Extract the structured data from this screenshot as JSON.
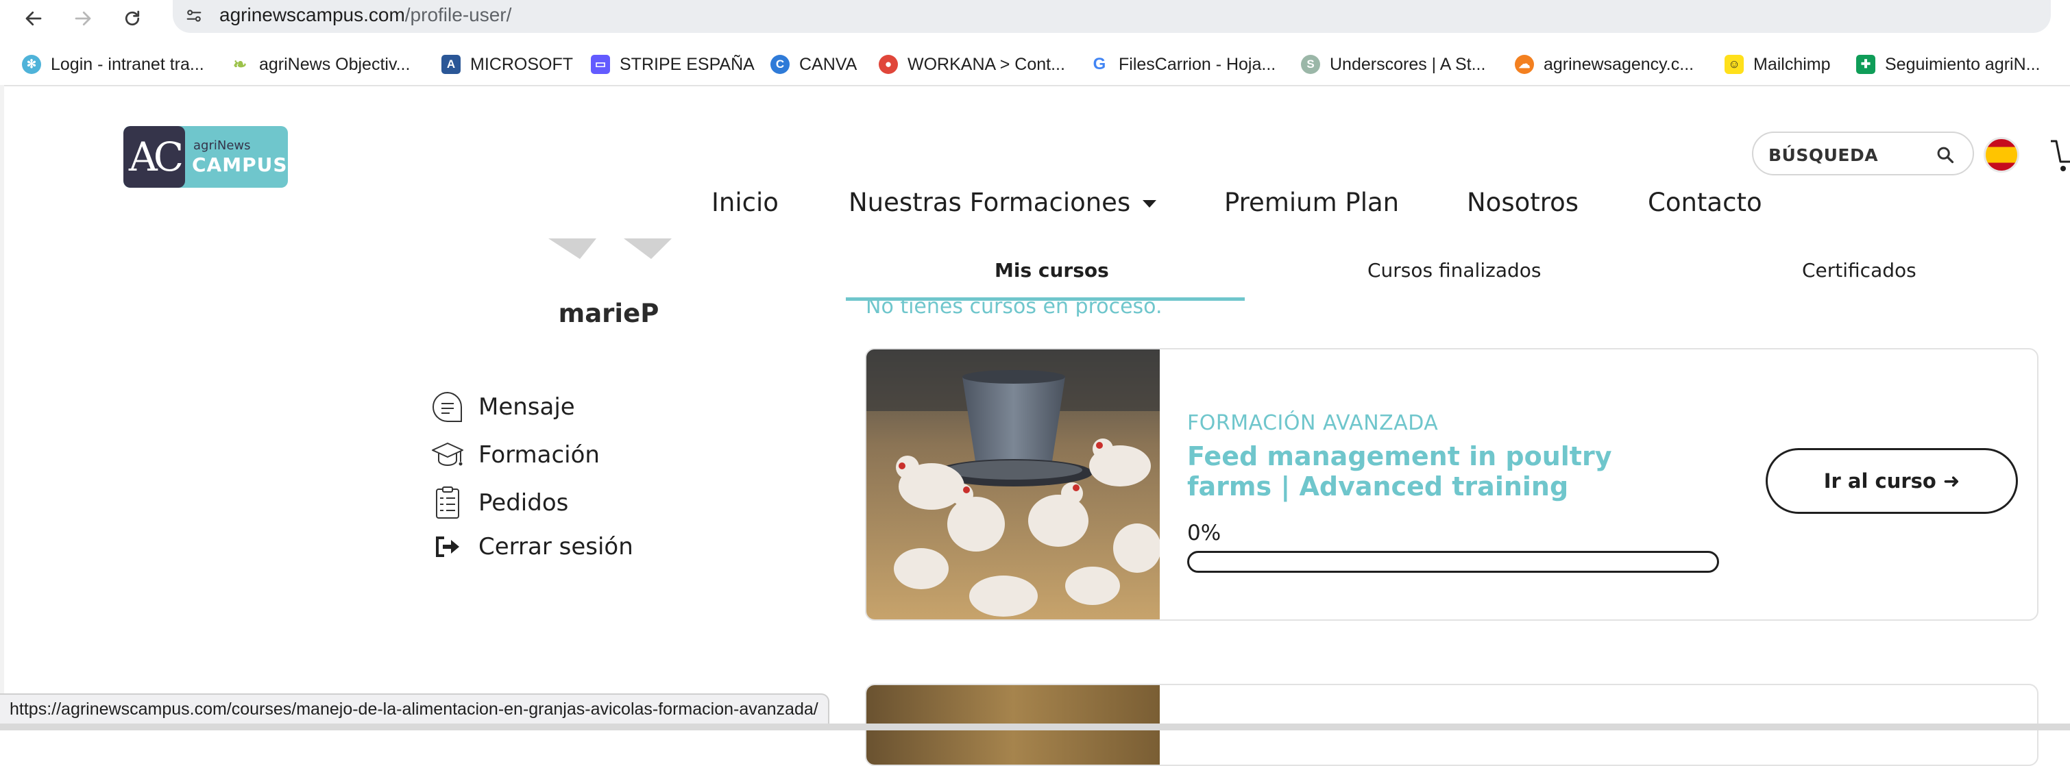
{
  "browser": {
    "url_host": "agrinewscampus.com",
    "url_path": "/profile-user/",
    "status_url": "https://agrinewscampus.com/courses/manejo-de-la-alimentacion-en-granjas-avicolas-formacion-avanzada/"
  },
  "bookmarks": [
    {
      "label": "Login - intranet tra...",
      "icon": "snowflake-icon",
      "color": "#4fb3d9"
    },
    {
      "label": "agriNews Objectiv...",
      "icon": "leaf-icon",
      "color": "#9cc24a"
    },
    {
      "label": "MICROSOFT",
      "icon": "microsoft-ai-icon",
      "color": "#2b5797"
    },
    {
      "label": "STRIPE ESPAÑA",
      "icon": "stripe-icon",
      "color": "#635bff"
    },
    {
      "label": "CANVA",
      "icon": "canva-icon",
      "color": "#2f7bd8"
    },
    {
      "label": "WORKANA > Cont...",
      "icon": "workana-icon",
      "color": "#e0463a"
    },
    {
      "label": "FilesCarrion - Hoja...",
      "icon": "google-icon",
      "color": "#4285f4"
    },
    {
      "label": "Underscores | A St...",
      "icon": "underscores-icon",
      "color": "#9bb7a8"
    },
    {
      "label": "agrinewsagency.c...",
      "icon": "cloudflare-icon",
      "color": "#f38020"
    },
    {
      "label": "Mailchimp",
      "icon": "mailchimp-icon",
      "color": "#ffe01b"
    },
    {
      "label": "Seguimiento agriN...",
      "icon": "sheets-icon",
      "color": "#0f9d58"
    }
  ],
  "logo": {
    "small": "agriNews",
    "big": "CAMPUS",
    "mark": "AC"
  },
  "header": {
    "search_placeholder": "BÚSQUEDA"
  },
  "nav": {
    "inicio": "Inicio",
    "formaciones": "Nuestras Formaciones",
    "premium": "Premium Plan",
    "nosotros": "Nosotros",
    "contacto": "Contacto"
  },
  "profile": {
    "username": "marieP",
    "menu": {
      "mensaje": "Mensaje",
      "formacion": "Formación",
      "pedidos": "Pedidos",
      "cerrar": "Cerrar sesión"
    }
  },
  "tabs": {
    "mis_cursos": "Mis cursos",
    "finalizados": "Cursos finalizados",
    "certificados": "Certificados"
  },
  "empty_message": "No tienes cursos en proceso.",
  "course": {
    "category": "FORMACIÓN AVANZADA",
    "title": "Feed management in poultry farms | Advanced training",
    "progress_label": "0%",
    "progress_fraction": 0,
    "button_label": "Ir al curso ➜"
  },
  "colors": {
    "accent": "#6fc6cc",
    "logo_dark": "#35344a"
  }
}
